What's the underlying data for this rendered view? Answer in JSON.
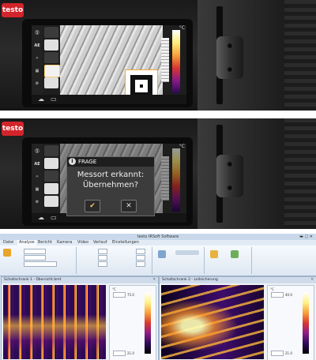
{
  "brand": {
    "logo_text": "testo",
    "accent": "#d3242b"
  },
  "camera_screen": {
    "unit": "°C",
    "left_toolbar": [
      "Ⓢ",
      "AE",
      "✧",
      "▦",
      "⚙"
    ],
    "scale_top": "30",
    "scale_bottom": "5",
    "marker_icon": "qr-marker-icon"
  },
  "dialog": {
    "title": "FRAGE",
    "info_icon": "i",
    "message": "Messort erkannt:\nÜbernehmen?",
    "confirm_icon": "✔",
    "cancel_icon": "✕"
  },
  "software": {
    "window_title": "testo IRSoft Software",
    "menu": [
      "Datei",
      "Analyse",
      "Bericht",
      "Kamera",
      "Video",
      "Verlauf",
      "Einstellungen"
    ],
    "documents": [
      {
        "tab": "Schaltschrank 1 - Übersicht.bmt",
        "scale_top": "75.0",
        "scale_bottom": "21.0"
      },
      {
        "tab": "Schaltschrank 2 - Leitsicherung",
        "scale_top": "40.0",
        "scale_bottom": "21.0"
      }
    ],
    "legend_unit": "°C"
  }
}
